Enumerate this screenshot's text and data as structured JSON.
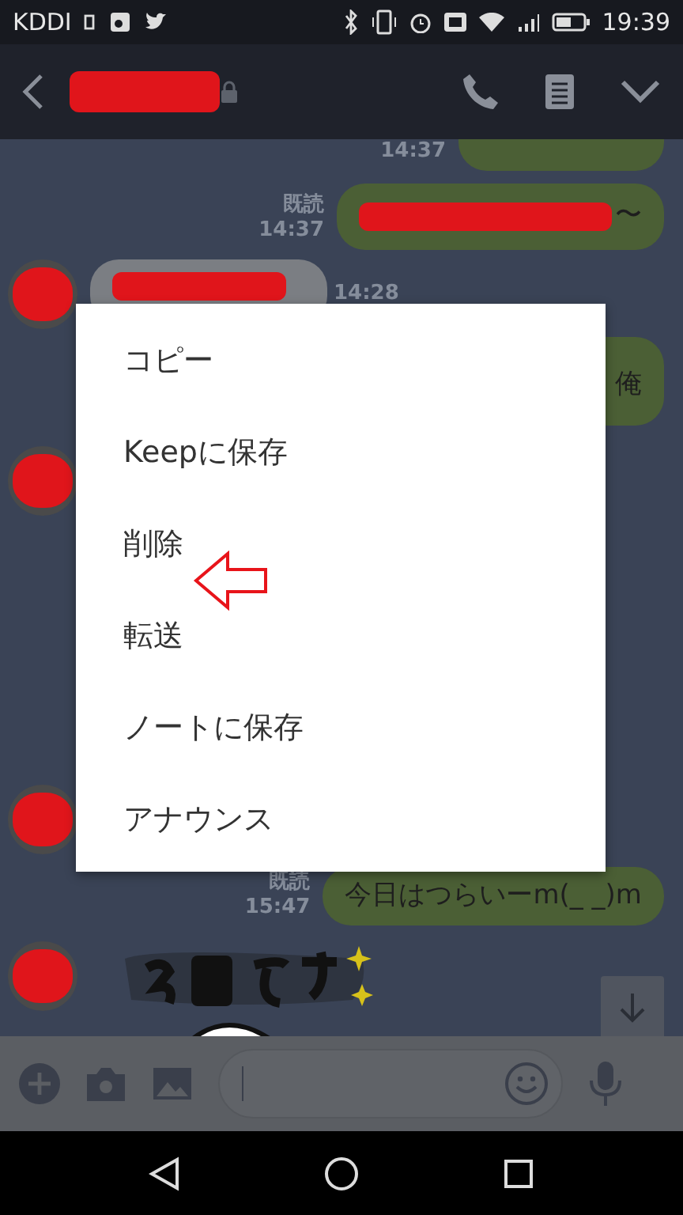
{
  "status_bar": {
    "carrier": "KDDI",
    "time": "19:39"
  },
  "header": {
    "title_redacted": true
  },
  "messages": [
    {
      "kind": "sent",
      "time": "14:37"
    },
    {
      "kind": "sent",
      "read_label": "既読",
      "time": "14:37",
      "text": "〜",
      "redacted": true
    },
    {
      "kind": "received",
      "time": "14:28",
      "redacted": true
    },
    {
      "kind": "sent",
      "text": "俺"
    },
    {
      "kind": "avatar"
    },
    {
      "kind": "avatar"
    },
    {
      "kind": "sent",
      "read_label": "既読",
      "time": "15:47",
      "text": "今日はつらいーm(_ _)m"
    },
    {
      "kind": "sticker"
    }
  ],
  "context_menu": {
    "items": [
      "コピー",
      "Keepに保存",
      "削除",
      "転送",
      "ノートに保存",
      "アナウンス"
    ]
  }
}
